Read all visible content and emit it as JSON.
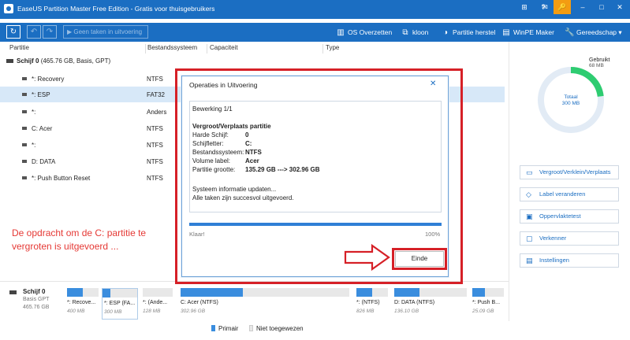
{
  "titlebar": {
    "title": "EaseUS Partition Master Free Edition - Gratis voor thuisgebruikers",
    "buttons": [
      "⊞",
      "?",
      "✉",
      "🔑",
      "–",
      "□",
      "✕"
    ]
  },
  "toolbar": {
    "refresh_icon": "↻",
    "undo_icon": "↶",
    "redo_icon": "↷",
    "pending_label": "▶ Geen taken in uitvoering",
    "items": [
      {
        "icon": "▥",
        "label": "OS Overzetten"
      },
      {
        "icon": "⧉",
        "label": "kloon"
      },
      {
        "icon": "◑",
        "label": "Partitie herstel"
      },
      {
        "icon": "▤",
        "label": "WinPE Maker"
      },
      {
        "icon": "🔧",
        "label": "Gereedschap ▾"
      }
    ]
  },
  "columns": {
    "partition": "Partitie",
    "fs": "Bestandssysteem",
    "capacity": "Capaciteit",
    "type": "Type"
  },
  "disk": {
    "name": "Schijf 0",
    "info": "(465.76 GB, Basis, GPT)"
  },
  "partitions": [
    {
      "name": "*: Recovery",
      "fs": "NTFS"
    },
    {
      "name": "*: ESP",
      "fs": "FAT32"
    },
    {
      "name": "*:",
      "fs": "Anders"
    },
    {
      "name": "C: Acer",
      "fs": "NTFS"
    },
    {
      "name": "*:",
      "fs": "NTFS"
    },
    {
      "name": "D: DATA",
      "fs": "NTFS"
    },
    {
      "name": "*: Push Button Reset",
      "fs": "NTFS"
    }
  ],
  "annotation": "De opdracht om de C: partitie te vergroten is uitgevoerd ...",
  "usage": {
    "used_label": "Gebruikt",
    "used_value": "68 MB",
    "total_label": "Totaal",
    "total_value": "300 MB",
    "used_fraction": 0.23
  },
  "actions": [
    {
      "icon": "▭",
      "label": "Vergroot/Verklein/Verplaats"
    },
    {
      "icon": "◇",
      "label": "Label veranderen"
    },
    {
      "icon": "▣",
      "label": "Oppervlaktetest"
    },
    {
      "icon": "▢",
      "label": "Verkenner"
    },
    {
      "icon": "▤",
      "label": "Instellingen"
    }
  ],
  "bottom_disk": {
    "name": "Schijf 0",
    "type": "Basis GPT",
    "size": "465.76 GB"
  },
  "segments": [
    {
      "name": "*: Recove...",
      "size": "400 MB",
      "fill": 0.5
    },
    {
      "name": "*: ESP (FA...",
      "size": "300 MB",
      "fill": 0.23
    },
    {
      "name": "*: (Ande...",
      "size": "128 MB",
      "fill": 0.0
    },
    {
      "name": "C: Acer (NTFS)",
      "size": "302.96 GB",
      "fill": 0.37
    },
    {
      "name": "*: (NTFS)",
      "size": "826 MB",
      "fill": 0.5
    },
    {
      "name": "D: DATA (NTFS)",
      "size": "136.10 GB",
      "fill": 0.35
    },
    {
      "name": "*: Push B...",
      "size": "25.09 GB",
      "fill": 0.4
    }
  ],
  "legend": {
    "primary": "Primair",
    "unallocated": "Niet toegewezen"
  },
  "dialog": {
    "title": "Operaties in Uitvoering",
    "close_icon": "✕",
    "step": "Bewerking 1/1",
    "op_title": "Vergroot/Verplaats partitie",
    "fields": [
      {
        "label": "Harde Schijf:",
        "value": "0"
      },
      {
        "label": "Schijfletter:",
        "value": "C:"
      },
      {
        "label": "Bestandssysteem:",
        "value": "NTFS"
      },
      {
        "label": "Volume label:",
        "value": "Acer"
      },
      {
        "label": "Partitie grootte:",
        "value": "135.29 GB ---> 302.96 GB"
      }
    ],
    "line1": "Systeem informatie updaten...",
    "line2": "Alle taken zijn succesvol uitgevoerd.",
    "status": "Klaar!",
    "percent": "100%",
    "progress": 1.0,
    "finish_button": "Einde"
  }
}
